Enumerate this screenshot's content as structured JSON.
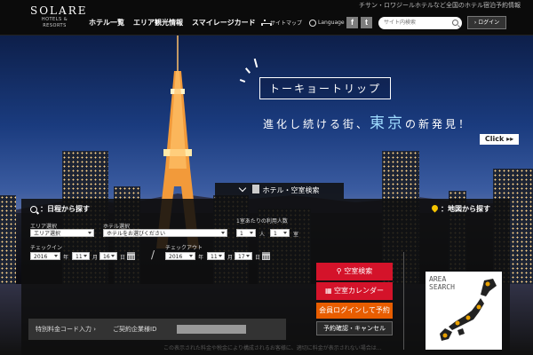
{
  "header": {
    "logo_main": "SOLARE",
    "logo_sub": "HOTELS & RESORTS",
    "tagline": "チサン・ロワジールホテルなど全国のホテル宿泊予約情報",
    "nav": [
      "ホテル一覧",
      "エリア観光情報",
      "スマイレージカード"
    ],
    "sitemap": "サイトマップ",
    "language": "Language",
    "facebook": "f",
    "twitter": "t",
    "search_placeholder": "サイト内検索",
    "login": "› ログイン"
  },
  "hero": {
    "promo_title": "トーキョートリップ",
    "promo_pre": "進化し続ける街、",
    "promo_city": "東京",
    "promo_post": "の新発見！",
    "click": "Click ▸▸"
  },
  "search": {
    "tab_label": "ホテル・空室検索",
    "schedule_title": "：日程から探す",
    "map_title": "：地図から探す",
    "area_label": "エリア選択",
    "area_value": "エリア選択",
    "hotel_label": "ホテル選択",
    "hotel_value": "ホテルをお選びください",
    "guests_label": "1室あたりの利用人数",
    "guests_value": "1",
    "guests_unit": "人",
    "rooms_value": "1",
    "rooms_unit": "室",
    "checkin_label": "チェックイン",
    "checkout_label": "チェックアウト",
    "checkin_year": "2016",
    "checkin_month": "11",
    "checkin_day": "16",
    "checkout_year": "2016",
    "checkout_month": "11",
    "checkout_day": "17",
    "year_unit": "年",
    "month_unit": "月",
    "day_unit": "日",
    "slash": "/",
    "btn_search": "空室検索",
    "btn_calendar": "空室カレンダー",
    "btn_member": "会員ログインして予約",
    "btn_confirm": "予約確認・キャンセル",
    "special_code": "特別料金コード入力",
    "corp_label": "ご契約企業様ID",
    "area_search_line1": "AREA",
    "area_search_line2": "SEARCH",
    "footer_note": "この表示された料金や税金により構成されるお客様に、適切に料金が表示されない場合は…"
  },
  "colors": {
    "red": "#d4132a",
    "orange": "#e85d00",
    "highlight": "#9fdcff"
  }
}
